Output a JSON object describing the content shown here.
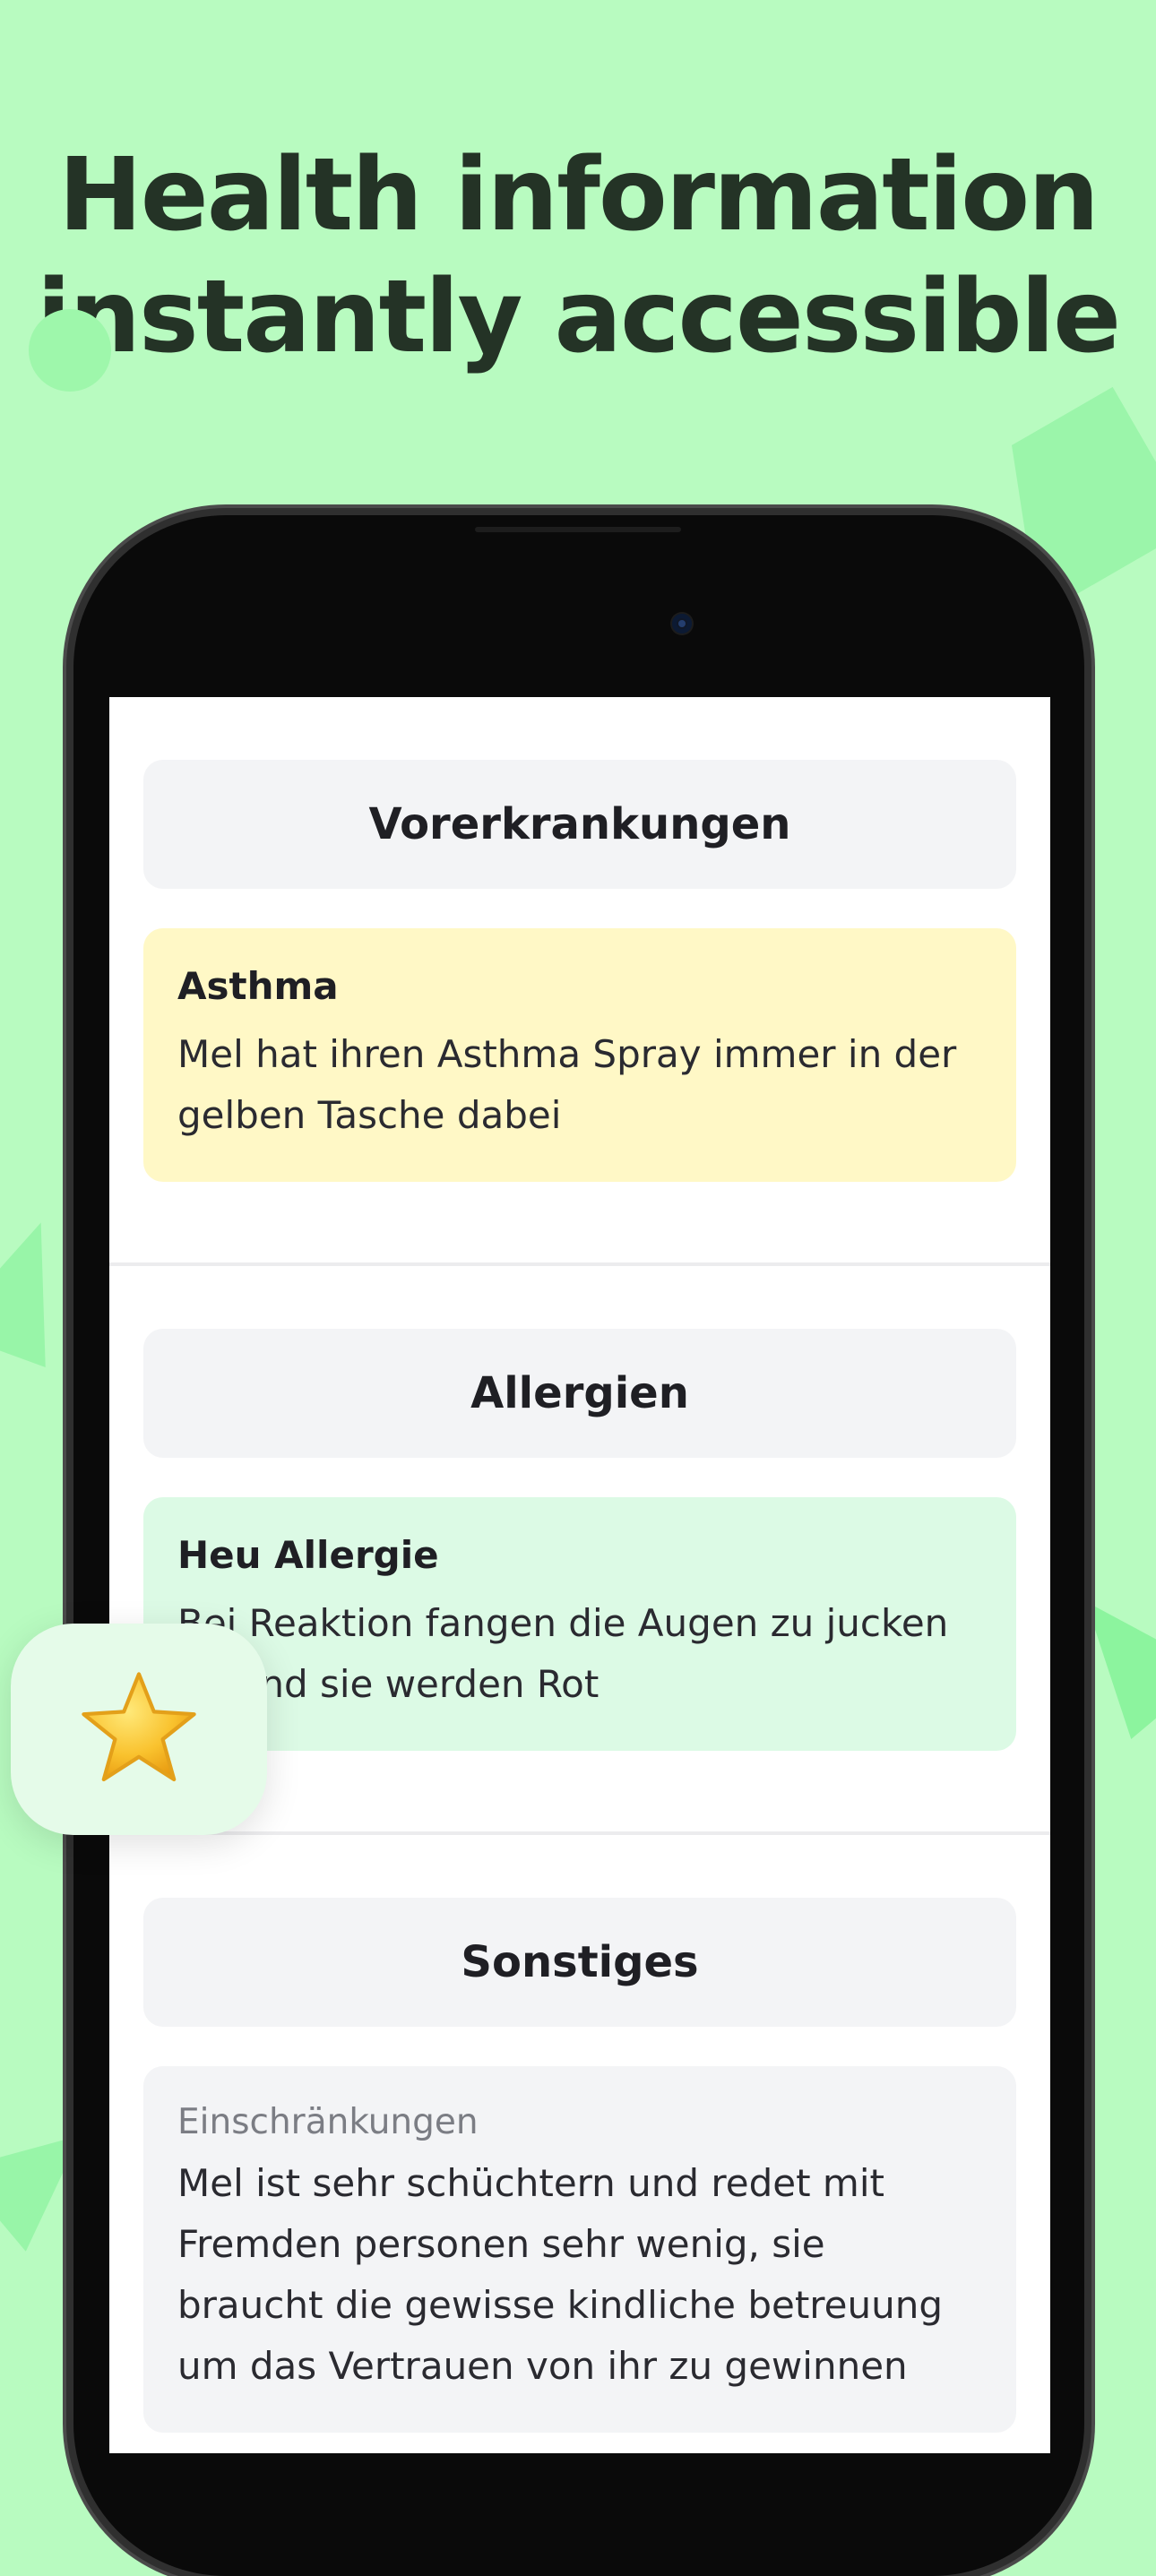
{
  "headline": {
    "line1": "Health information",
    "line2": "instantly accessible"
  },
  "colors": {
    "background": "#b8fbc0",
    "headline": "#243326",
    "yellow_card": "#fff8c6",
    "green_card": "#dcfae5",
    "section_head": "#f3f4f6"
  },
  "sections": [
    {
      "title": "Vorerkrankungen",
      "card": {
        "title": "Asthma",
        "body": "Mel hat ihren Asthma Spray immer in der gelben Tasche dabei"
      }
    },
    {
      "title": "Allergien",
      "card": {
        "title": "Heu Allergie",
        "body": "Bei Reaktion fangen die Augen zu jucken an und sie werden Rot"
      }
    },
    {
      "title": "Sonstiges",
      "card": {
        "subtitle": "Einschränkungen",
        "body": "Mel ist sehr schüchtern und redet mit Fremden personen sehr wenig, sie braucht die gewisse kindliche betreuung um das Vertrauen von ihr zu gewinnen"
      }
    }
  ],
  "badge": {
    "icon": "star-icon"
  }
}
